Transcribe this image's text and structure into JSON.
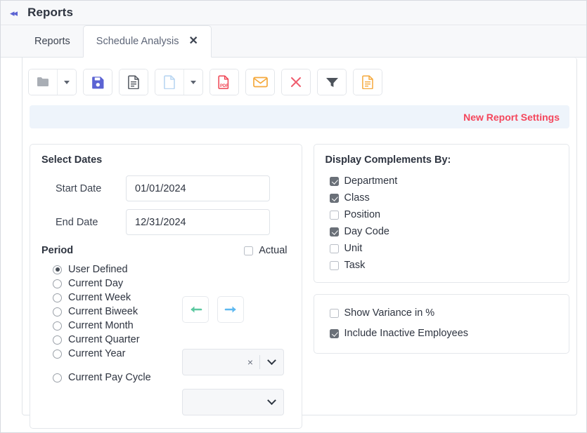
{
  "header": {
    "collapse_icon": "collapse-left-icon",
    "title": "Reports"
  },
  "tabs": [
    {
      "label": "Reports",
      "active": false
    },
    {
      "label": "Schedule Analysis",
      "active": true,
      "close_label": "✕"
    }
  ],
  "toolbar": {
    "buttons": [
      {
        "name": "open-folder-button",
        "icon": "folder-icon",
        "color": "#a9aeb5",
        "has_caret": true
      },
      {
        "name": "save-button",
        "icon": "floppy-disk-icon",
        "color": "#5b63d3",
        "has_caret": false
      },
      {
        "name": "report-document-button",
        "icon": "document-lines-icon",
        "color": "#51565e",
        "has_caret": false
      },
      {
        "name": "new-document-button",
        "icon": "blank-page-icon",
        "color": "#b9d6f2",
        "has_caret": true
      },
      {
        "name": "export-pdf-button",
        "icon": "pdf-icon",
        "color": "#ef4352",
        "has_caret": false
      },
      {
        "name": "email-button",
        "icon": "envelope-icon",
        "color": "#f5a93c",
        "has_caret": false
      },
      {
        "name": "delete-button",
        "icon": "close-x-icon",
        "color": "#ef5d6e",
        "has_caret": false
      },
      {
        "name": "filter-button",
        "icon": "funnel-icon",
        "color": "#4d535b",
        "has_caret": false
      },
      {
        "name": "export-document-button",
        "icon": "document-orange-icon",
        "color": "#f5a93c",
        "has_caret": false
      }
    ]
  },
  "notice": {
    "link_label": "New Report Settings",
    "link_color": "#f4465c"
  },
  "select_dates": {
    "title": "Select Dates",
    "start_label": "Start Date",
    "start_value": "01/01/2024",
    "end_label": "End Date",
    "end_value": "12/31/2024"
  },
  "period": {
    "title": "Period",
    "actual": {
      "label": "Actual",
      "checked": false
    },
    "options": [
      {
        "label": "User Defined",
        "selected": true
      },
      {
        "label": "Current Day",
        "selected": false
      },
      {
        "label": "Current Week",
        "selected": false
      },
      {
        "label": "Current Biweek",
        "selected": false
      },
      {
        "label": "Current Month",
        "selected": false
      },
      {
        "label": "Current Quarter",
        "selected": false
      },
      {
        "label": "Current Year",
        "selected": false
      }
    ],
    "pay_cycle": {
      "label": "Current Pay Cycle",
      "selected": false
    },
    "prev_arrow": "arrow-left-icon",
    "next_arrow": "arrow-right-icon",
    "prev_arrow_color": "#5bc8a0",
    "next_arrow_color": "#5db8f0",
    "period_select_value": "",
    "period_select_clear": "×",
    "pay_cycle_select_value": ""
  },
  "display_complements": {
    "title": "Display Complements By:",
    "items": [
      {
        "label": "Department",
        "checked": true
      },
      {
        "label": "Class",
        "checked": true
      },
      {
        "label": "Position",
        "checked": false
      },
      {
        "label": "Day Code",
        "checked": true
      },
      {
        "label": "Unit",
        "checked": false
      },
      {
        "label": "Task",
        "checked": false
      }
    ]
  },
  "options_panel": {
    "items": [
      {
        "label": "Show Variance in %",
        "checked": false
      },
      {
        "label": "Include Inactive Employees",
        "checked": true
      }
    ]
  }
}
